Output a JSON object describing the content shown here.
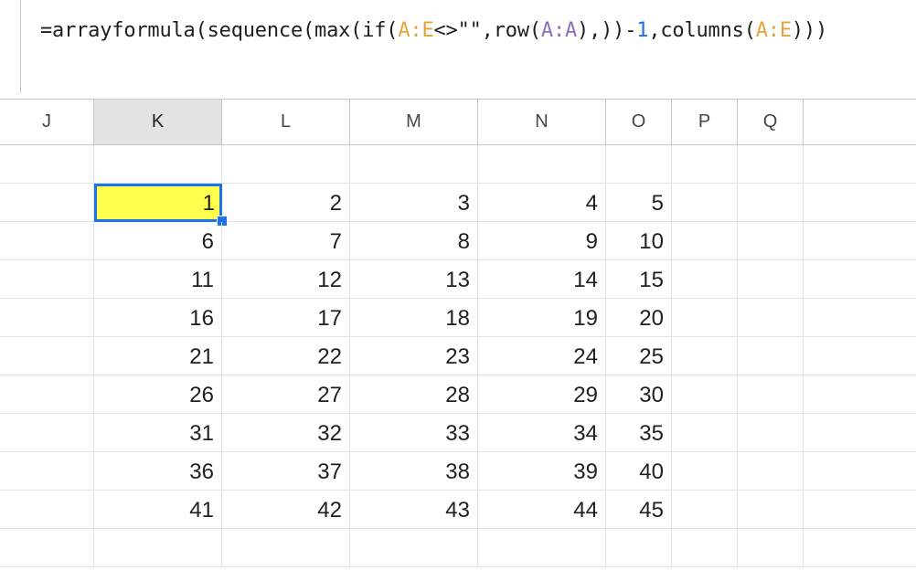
{
  "formula_bar": {
    "tokens": [
      {
        "text": "=arrayformula(sequence(max(if(",
        "kind": "plain"
      },
      {
        "text": "A:E",
        "kind": "range"
      },
      {
        "text": "<>\"\",row(",
        "kind": "plain"
      },
      {
        "text": "A:A",
        "kind": "range2"
      },
      {
        "text": "),))-",
        "kind": "plain"
      },
      {
        "text": "1",
        "kind": "num"
      },
      {
        "text": ",columns(",
        "kind": "plain"
      },
      {
        "text": "A:E",
        "kind": "range"
      },
      {
        "text": ")))",
        "kind": "plain"
      }
    ]
  },
  "columns": [
    "J",
    "K",
    "L",
    "M",
    "N",
    "O",
    "P",
    "Q"
  ],
  "selected_column": "K",
  "active_cell": {
    "col": "K",
    "row_index": 1
  },
  "rows": [
    [
      "",
      "",
      "",
      "",
      "",
      "",
      "",
      ""
    ],
    [
      "",
      "1",
      "2",
      "3",
      "4",
      "5",
      "",
      ""
    ],
    [
      "",
      "6",
      "7",
      "8",
      "9",
      "10",
      "",
      ""
    ],
    [
      "",
      "11",
      "12",
      "13",
      "14",
      "15",
      "",
      ""
    ],
    [
      "",
      "16",
      "17",
      "18",
      "19",
      "20",
      "",
      ""
    ],
    [
      "",
      "21",
      "22",
      "23",
      "24",
      "25",
      "",
      ""
    ],
    [
      "",
      "26",
      "27",
      "28",
      "29",
      "30",
      "",
      ""
    ],
    [
      "",
      "31",
      "32",
      "33",
      "34",
      "35",
      "",
      ""
    ],
    [
      "",
      "36",
      "37",
      "38",
      "39",
      "40",
      "",
      ""
    ],
    [
      "",
      "41",
      "42",
      "43",
      "44",
      "45",
      "",
      ""
    ],
    [
      "",
      "",
      "",
      "",
      "",
      "",
      "",
      ""
    ]
  ],
  "colors": {
    "active_fill": "#ffff4d",
    "selection_border": "#1a73e8",
    "range_token": "#e8a23a",
    "range2_token": "#8e6fbf",
    "number_token": "#1a73e8"
  }
}
